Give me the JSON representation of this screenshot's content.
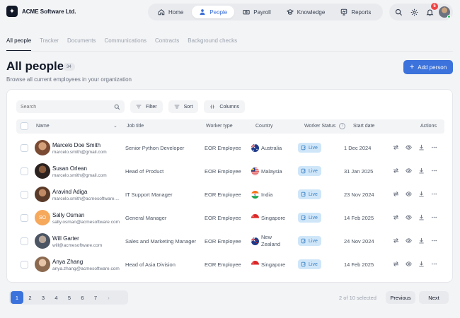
{
  "app": {
    "name": "ACME Software Ltd."
  },
  "nav": {
    "items": [
      {
        "label": "Home",
        "icon": "home-icon"
      },
      {
        "label": "People",
        "icon": "people-icon"
      },
      {
        "label": "Payroll",
        "icon": "payroll-icon"
      },
      {
        "label": "Knowledge",
        "icon": "knowledge-icon"
      },
      {
        "label": "Reports",
        "icon": "reports-icon"
      }
    ],
    "active": "People"
  },
  "top_actions": {
    "notification_count": "5"
  },
  "tabs": [
    {
      "label": "All people"
    },
    {
      "label": "Tracker"
    },
    {
      "label": "Documents"
    },
    {
      "label": "Communications"
    },
    {
      "label": "Contracts"
    },
    {
      "label": "Background checks"
    }
  ],
  "page": {
    "title": "All people",
    "count": "34",
    "subtitle": "Browse all current employees in your organization",
    "add_button": "Add person"
  },
  "toolbar": {
    "search_placeholder": "Search",
    "filter": "Filter",
    "sort": "Sort",
    "columns": "Columns"
  },
  "table": {
    "headers": {
      "name": "Name",
      "job_title": "Job title",
      "worker_type": "Worker type",
      "country": "Country",
      "worker_status": "Worker Status",
      "start_date": "Start date",
      "actions": "Actions"
    },
    "rows": [
      {
        "name": "Marcelo Doe Smith",
        "email": "marcelo.smith@gmail.com",
        "job": "Senior Python Developer",
        "worker_type": "EOR Employee",
        "country": "Australia",
        "flag": "AU",
        "status": "Live",
        "start": "1 Dec 2024",
        "initials": ""
      },
      {
        "name": "Susan Orlean",
        "email": "marcelo.smith@gmail.com",
        "job": "Head of Product",
        "worker_type": "EOR Employee",
        "country": "Malaysia",
        "flag": "MY",
        "status": "Live",
        "start": "31 Jan 2025",
        "initials": ""
      },
      {
        "name": "Aravind Adiga",
        "email": "marcelo.smith@acmesoftware....",
        "job": "IT Support Manager",
        "worker_type": "EOR Employee",
        "country": "India",
        "flag": "IN",
        "status": "Live",
        "start": "23 Nov 2024",
        "initials": ""
      },
      {
        "name": "Sally Osman",
        "email": "sally.osman@acmesoftware.com",
        "job": "General Manager",
        "worker_type": "EOR Employee",
        "country": "Singapore",
        "flag": "SG",
        "status": "Live",
        "start": "14 Feb 2025",
        "initials": "SO"
      },
      {
        "name": "Will Garter",
        "email": "will@acmesoftware.com",
        "job": "Sales and Marketing Manager",
        "worker_type": "EOR Employee",
        "country_line1": "New",
        "country_line2": "Zealand",
        "flag": "NZ",
        "status": "Live",
        "start": "24 Nov 2024",
        "initials": ""
      },
      {
        "name": "Anya Zhang",
        "email": "anya.zhang@acmesoftware.com",
        "job": "Head of Asia Division",
        "worker_type": "EOR Employee",
        "country": "Singapore",
        "flag": "SG",
        "status": "Live",
        "start": "14 Feb 2025",
        "initials": ""
      }
    ]
  },
  "pagination": {
    "pages": [
      "1",
      "2",
      "3",
      "4",
      "5",
      "6",
      "7"
    ],
    "current": "1",
    "next_glyph": "›",
    "selected_text": "2 of 10 selected",
    "previous": "Previous",
    "next": "Next"
  },
  "colors": {
    "accent": "#3b72db",
    "status_bg": "#cfe6f9",
    "status_text": "#3b82c4",
    "badge": "#ef4444"
  }
}
